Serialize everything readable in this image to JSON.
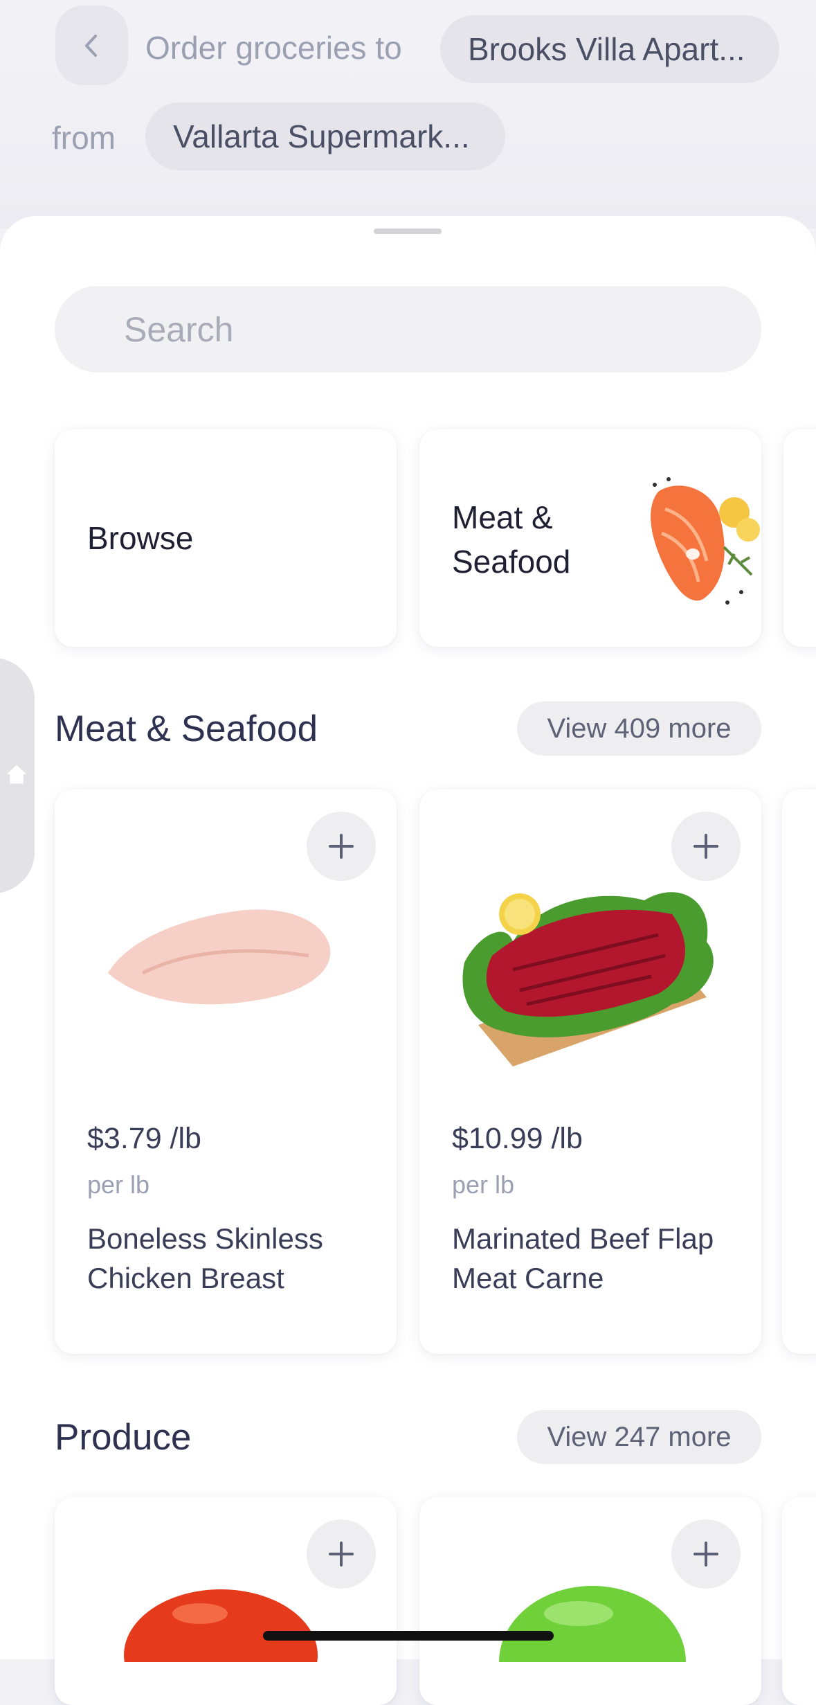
{
  "header": {
    "order_label": "Order groceries to",
    "address": "Brooks Villa Apart...",
    "from_label": "from",
    "store": "Vallarta Supermark..."
  },
  "search": {
    "placeholder": "Search"
  },
  "categories": [
    {
      "label": "Browse"
    },
    {
      "label_line1": "Meat &",
      "label_line2": "Seafood"
    }
  ],
  "sections": [
    {
      "title": "Meat & Seafood",
      "view_more": "View 409 more",
      "products": [
        {
          "price": "$3.79 /lb",
          "unit": "per lb",
          "name_line1": "Boneless Skinless",
          "name_line2": "Chicken Breast"
        },
        {
          "price": "$10.99 /lb",
          "unit": "per lb",
          "name_line1": "Marinated Beef Flap",
          "name_line2": "Meat Carne"
        }
      ]
    },
    {
      "title": "Produce",
      "view_more": "View 247 more"
    }
  ],
  "colors": {
    "text": "#2e3150",
    "muted": "#9ba0b3",
    "pill": "#e4e4ea"
  }
}
